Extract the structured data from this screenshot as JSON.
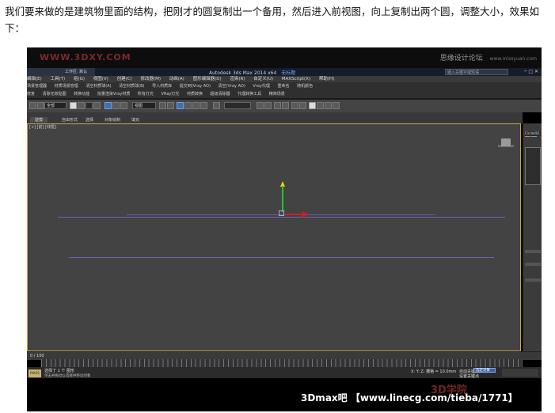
{
  "caption": "我们要来做的是建筑物里面的结构，把刚才的圆复制出一个备用，然后进入前视图，向上复制出两个圆，调整大小，效果如下：",
  "watermark": {
    "left": "WWW.3DXY.COM",
    "right": "思缘设计论坛",
    "right_small": "www.missyuan.com"
  },
  "window": {
    "title": "Autodesk 3ds Max 2014 x64",
    "title_doc": "无标题",
    "workspace": "工作区: 默认",
    "search_placeholder": "键入关键字或短语"
  },
  "menubar": {
    "items": [
      "编辑(E)",
      "工具(T)",
      "组(G)",
      "视图(V)",
      "创建(C)",
      "修改器(M)",
      "动画(A)",
      "图形编辑器(D)",
      "渲染(R)",
      "自定义(U)",
      "MAXScript(X)",
      "帮助(H)"
    ]
  },
  "plugin_rows": {
    "row1": [
      "场景管理器",
      "材质场景管理",
      "清空材质球(A)",
      "清空材质球(B)",
      "导入材质库",
      "提交到(Vray AO)",
      "清空(Vray AO)",
      "Vray代理",
      "重命名",
      "随机颜色"
    ],
    "row2": [
      "修复",
      "清除无效贴图",
      "转换功能",
      "批量渲染Vray材质",
      "所有灯光",
      "VRay灯光",
      "材质转换",
      "超级清除器",
      "代理转换工具",
      "精简场景"
    ],
    "row3": [
      "显示/隐藏",
      "当前视图",
      "缩放",
      "完全选择",
      "当前选择"
    ]
  },
  "toolbar": {
    "selection_filter": "全部",
    "ref_coord": "视图"
  },
  "ribbon": {
    "tabs": [
      "建模",
      "自由形式",
      "选择",
      "对象绘制",
      "填充"
    ]
  },
  "viewport": {
    "label": "[+] [前] [线框]"
  },
  "command_panel": {
    "object_name": "Circle001"
  },
  "timeline": {
    "frame_counter": "0 / 100",
    "ruler": [
      "0",
      "10",
      "20",
      "30",
      "40",
      "50",
      "60",
      "70",
      "80",
      "90",
      "100"
    ]
  },
  "statusbar": {
    "maxscript": "MAXS",
    "selection": "选择了 1 个 图形",
    "prompt": "单击并拖动以选择并移动对象",
    "coords": "X:  Y:  Z:   栅格 = 10.0mm",
    "autokey": "自动关键点",
    "setkey": "设置关键点",
    "key_mode": "选定对象"
  },
  "footer": {
    "url": "3Dmax吧 【www.linecg.com/tieba/1771】",
    "stamp": "3D学院"
  }
}
